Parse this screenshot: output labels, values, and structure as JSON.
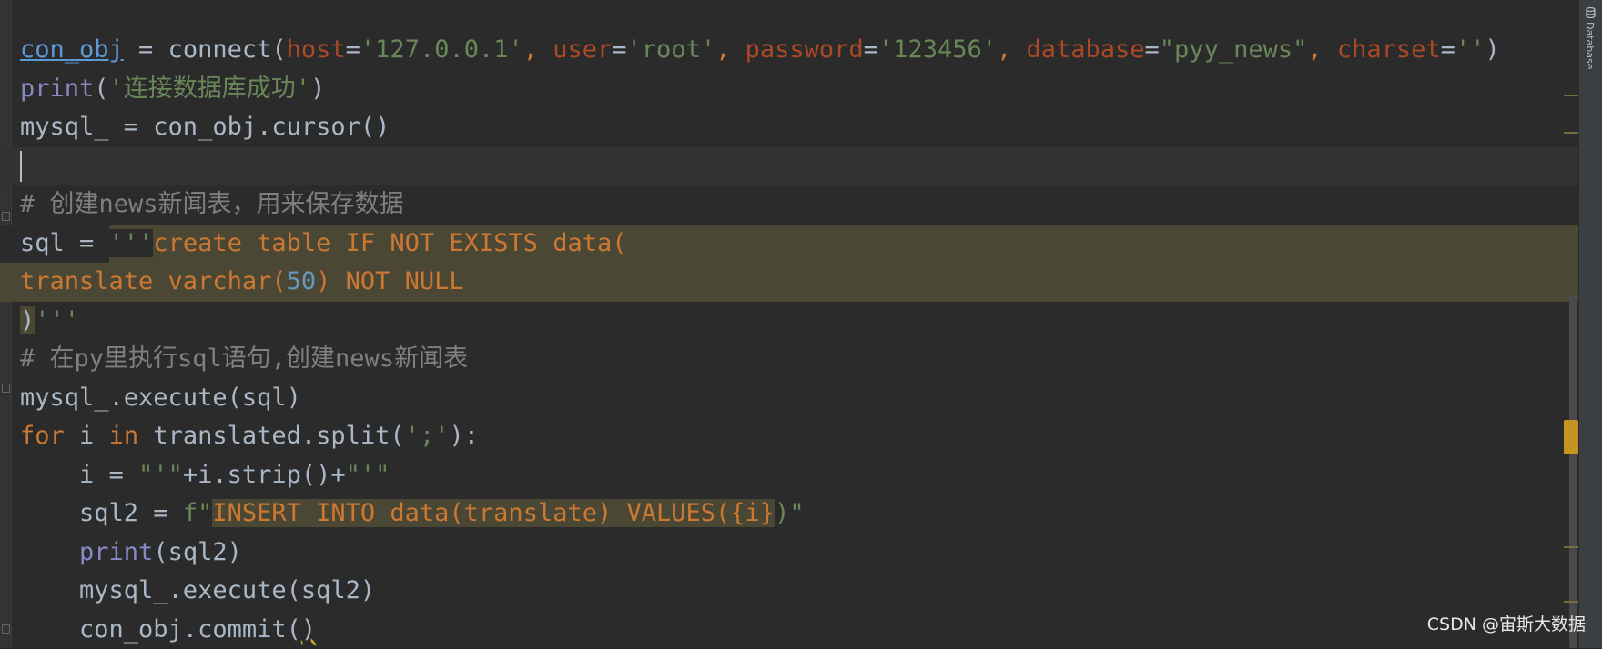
{
  "sidebar": {
    "label": "Database"
  },
  "code": {
    "l1": {
      "var": "con_obj",
      "eq": " = ",
      "fn": "connect(",
      "p1": "host",
      "v1": "'127.0.0.1'",
      "p2": "user",
      "v2": "'root'",
      "p3": "password",
      "v3": "'123456'",
      "p4": "database",
      "v4": "\"pyy_news\"",
      "p5": "charset",
      "v5": "''",
      "close": ")"
    },
    "l2": {
      "fn": "print",
      "arg": "'连接数据库成功'"
    },
    "l3": {
      "text": "mysql_ = con_obj.cursor()"
    },
    "l5": {
      "comment": "# 创建news新闻表，用来保存数据"
    },
    "l6": {
      "lead": "sql = ",
      "q": "'''",
      "sql": "create table IF NOT EXISTS data("
    },
    "l7": {
      "a": "translate varchar(",
      "n": "50",
      "b": ") NOT NULL"
    },
    "l8": {
      "p": ")",
      "q": "'''"
    },
    "l9": {
      "comment": "# 在py里执行sql语句,创建news新闻表"
    },
    "l10": {
      "text": "mysql_.execute(sql)"
    },
    "l11": {
      "kw1": "for",
      "mid1": " i ",
      "kw2": "in",
      "mid2": " translated.split(",
      "s": "';'",
      "end": "):"
    },
    "l12": {
      "a": "    i = ",
      "s1": "\"'\"",
      "mid": "+i.strip()+",
      "s2": "\"'\""
    },
    "l13": {
      "a": "    sql2 = ",
      "f": "f\"",
      "sql": "INSERT INTO data(translate) VALUES(",
      "brace": "{i}",
      "close": ")\""
    },
    "l14": {
      "ind": "    ",
      "fn": "print",
      "arg": "(sql2)"
    },
    "l15": {
      "text": "    mysql_.execute(sql2)"
    },
    "l16": {
      "a": "    con_obj.commit(",
      "b": ")"
    }
  },
  "watermark": "CSDN @宙斯大数据"
}
